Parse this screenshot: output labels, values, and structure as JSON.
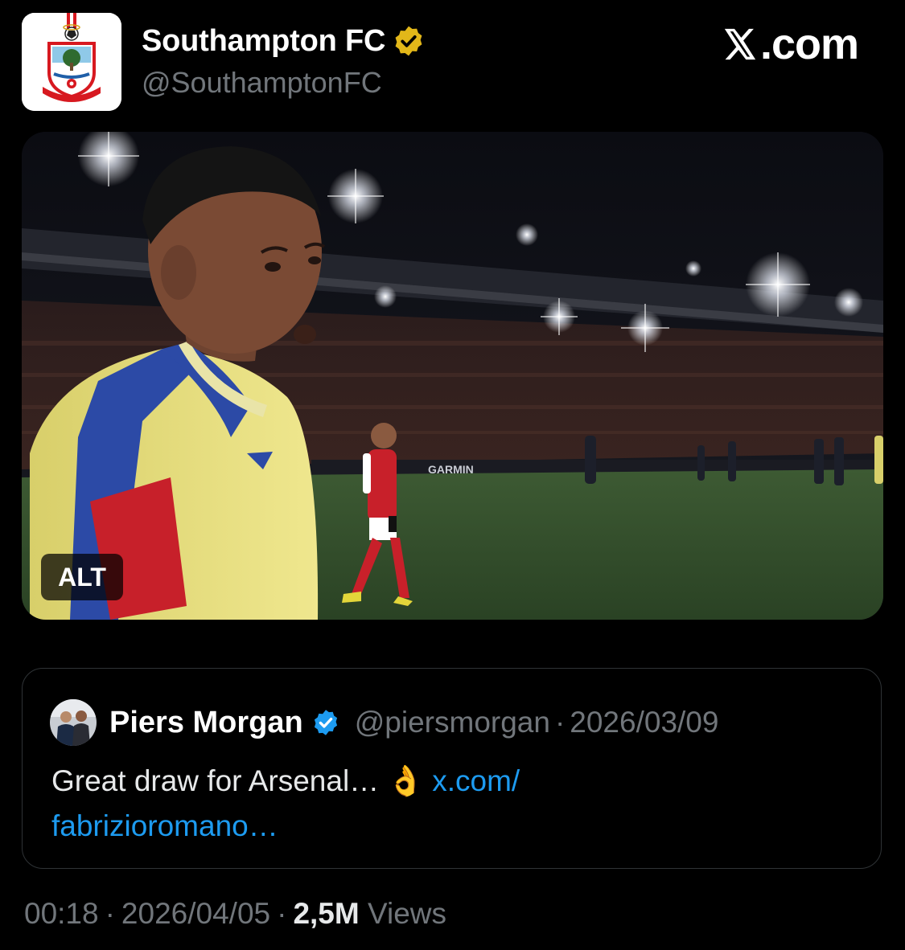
{
  "tweet": {
    "author": {
      "name": "Southampton FC",
      "handle": "@SouthamptonFC",
      "verified_color": "#e2b719",
      "avatar_icon": "southampton-crest-icon"
    },
    "site": {
      "logo_icon": "x-logo-icon",
      "label": ".com"
    },
    "media": {
      "alt_label": "ALT",
      "board_text": "GARMIN"
    },
    "quote": {
      "name": "Piers Morgan",
      "handle": "@piersmorgan",
      "separator": "·",
      "date": "2026/03/09",
      "verified_color": "#1d9bf0",
      "text": "Great draw for Arsenal…",
      "emoji": "👌",
      "link_line1": "x.com/",
      "link_line2": "fabrizioromano…"
    },
    "footer": {
      "time": "00:18",
      "separator": "·",
      "date": "2026/04/05",
      "views_count": "2,5M",
      "views_label": "Views"
    }
  },
  "colors": {
    "background": "#000000",
    "text_primary": "#e7e9ea",
    "text_secondary": "#71767b",
    "link": "#1d9bf0",
    "border": "#2f3336"
  }
}
